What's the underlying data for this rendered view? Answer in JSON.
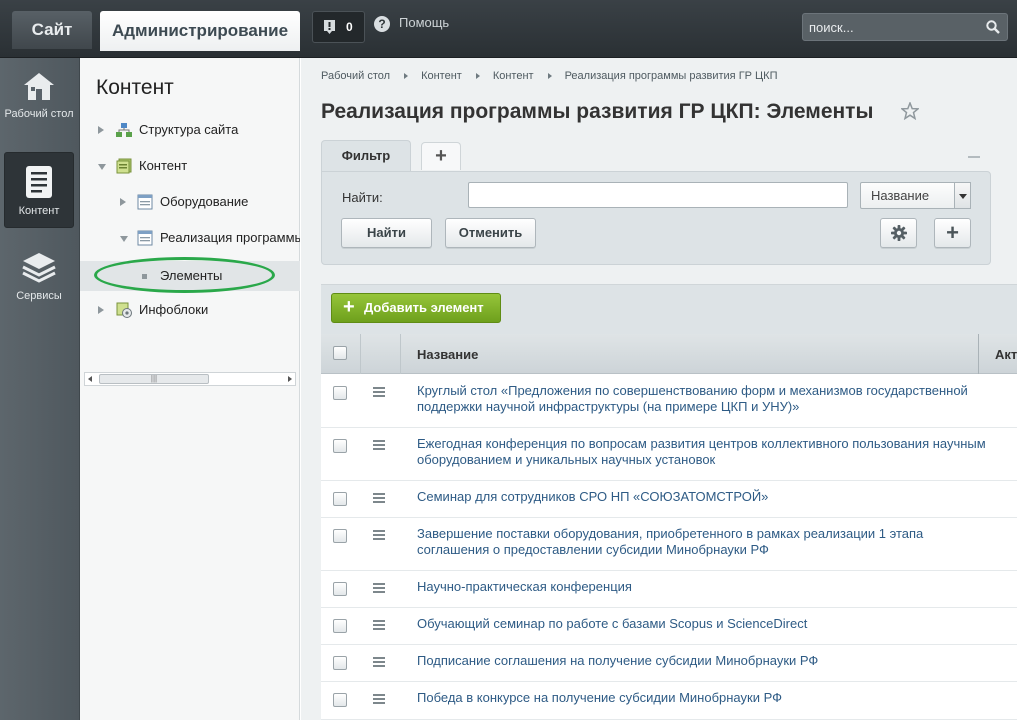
{
  "topbar": {
    "site_tab": "Сайт",
    "admin_tab": "Администрирование",
    "notifications_count": "0",
    "help_label": "Помощь",
    "search_placeholder": "поиск..."
  },
  "left_menu": [
    {
      "label": "Рабочий стол",
      "icon": "home-icon"
    },
    {
      "label": "Контент",
      "icon": "document-icon",
      "active": true
    },
    {
      "label": "Сервисы",
      "icon": "layers-icon"
    }
  ],
  "tree": {
    "title": "Контент",
    "nodes": [
      {
        "label": "Структура сайта",
        "level": 0,
        "expanded": false,
        "icon": "site-structure-icon"
      },
      {
        "label": "Контент",
        "level": 0,
        "expanded": true,
        "icon": "content-icon"
      },
      {
        "label": "Оборудование",
        "level": 1,
        "expanded": false,
        "icon": "iblock-icon"
      },
      {
        "label": "Реализация программы",
        "level": 1,
        "expanded": true,
        "icon": "iblock-icon"
      },
      {
        "label": "Элементы",
        "level": 2,
        "selected": true,
        "icon": "bullet-icon"
      },
      {
        "label": "Инфоблоки",
        "level": 0,
        "expanded": false,
        "icon": "infoblocks-icon"
      }
    ]
  },
  "breadcrumb": [
    "Рабочий стол",
    "Контент",
    "Контент",
    "Реализация программы развития ГР ЦКП"
  ],
  "page_title": "Реализация программы развития ГР ЦКП: Элементы",
  "filter": {
    "tab_label": "Фильтр",
    "add_tab": "+",
    "find_label": "Найти:",
    "find_value": "",
    "field_select": "Название",
    "find_button": "Найти",
    "cancel_button": "Отменить",
    "plus_button": "+"
  },
  "add_element_button": "Добавить элемент",
  "grid": {
    "columns": [
      "Название",
      "Акт"
    ],
    "rows": [
      "Круглый стол «Предложения по совершенствованию форм и механизмов государственной поддержки научной инфраструктуры (на примере ЦКП и УНУ)»",
      "Ежегодная конференция по вопросам развития центров коллективного пользования научным оборудованием и уникальных научных установок",
      "Семинар для сотрудников СРО НП «СОЮЗАТОМСТРОЙ»",
      "Завершение поставки оборудования, приобретенного в рамках реализации 1 этапа соглашения о предоставлении субсидии Минобрнауки РФ",
      "Научно-практическая конференция",
      "Обучающий семинар по работе с базами Scopus и ScienceDirect",
      "Подписание соглашения на получение субсидии Минобрнауки РФ",
      "Победа в конкурсе на получение субсидии Минобрнауки РФ"
    ]
  },
  "colors": {
    "link": "#2e5b85",
    "add_button": "#7fb02a",
    "highlight_oval": "#2aa84a"
  }
}
